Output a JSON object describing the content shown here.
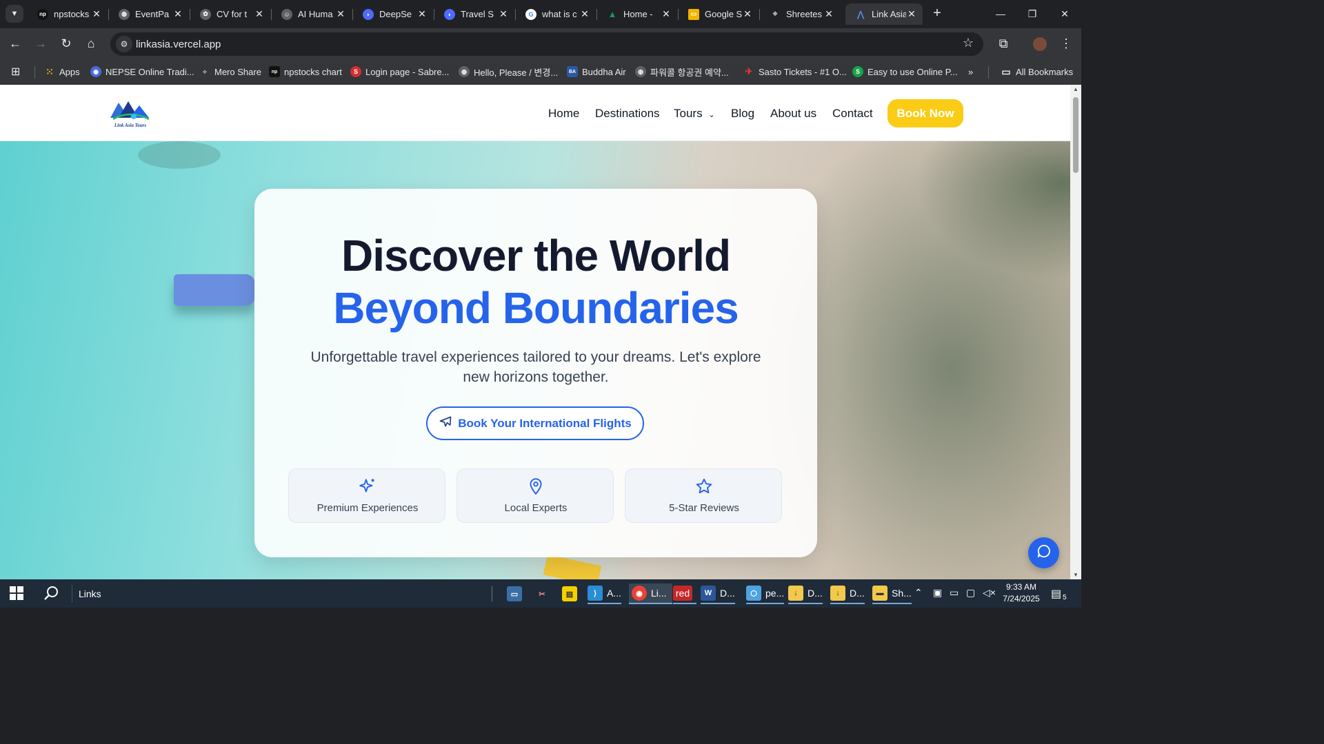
{
  "browser": {
    "tabs": [
      {
        "title": "npstocks",
        "icon": "np-icon",
        "fav_text": "np",
        "color": "#111111"
      },
      {
        "title": "EventPa",
        "icon": "globe-icon",
        "fav_text": "",
        "color": "#5f6368"
      },
      {
        "title": "CV for t",
        "icon": "openai-icon",
        "fav_text": "",
        "color": "#5f6368"
      },
      {
        "title": "AI Huma",
        "icon": "humanize-icon",
        "fav_text": "",
        "color": "#5f6368"
      },
      {
        "title": "DeepSe",
        "icon": "deepseek-icon",
        "fav_text": "",
        "color": "#4d6bfe"
      },
      {
        "title": "Travel S",
        "icon": "deepseek-icon",
        "fav_text": "",
        "color": "#4d6bfe"
      },
      {
        "title": "what is c",
        "icon": "google-icon",
        "fav_text": "G",
        "color": "#4285f4"
      },
      {
        "title": "Home - ",
        "icon": "drive-icon",
        "fav_text": "",
        "color": "#0f9d58"
      },
      {
        "title": "Google S",
        "icon": "slides-icon",
        "fav_text": "",
        "color": "#f4b400"
      },
      {
        "title": "Shreetes",
        "icon": "shreetes-icon",
        "fav_text": "",
        "color": "#5f6368"
      },
      {
        "title": "Link Asia",
        "icon": "linkasia-icon",
        "fav_text": "",
        "color": "#2563eb",
        "active": true
      }
    ],
    "url": "linkasia.vercel.app",
    "bookmarks": [
      {
        "label": "Apps",
        "icon": "apps-grid-icon",
        "color": "#e8eaed"
      },
      {
        "label": "NEPSE Online Tradi...",
        "icon": "nepse-icon",
        "color": "#4a6bd6"
      },
      {
        "label": "Mero Share",
        "icon": "mero-share-icon",
        "color": "#5f6368"
      },
      {
        "label": "npstocks chart",
        "icon": "np-icon",
        "color": "#111111"
      },
      {
        "label": "Login page - Sabre...",
        "icon": "sabre-icon",
        "color": "#d32f2f"
      },
      {
        "label": "Hello, Please / 변경...",
        "icon": "globe-icon",
        "color": "#5f6368"
      },
      {
        "label": "Buddha Air",
        "icon": "buddha-air-icon",
        "color": "#2b5aa0"
      },
      {
        "label": "파워콜 항공권 예약...",
        "icon": "globe-icon",
        "color": "#5f6368"
      },
      {
        "label": "Sasto Tickets - #1 O...",
        "icon": "plane-icon",
        "color": "#d32f2f"
      },
      {
        "label": "Easy to use Online P...",
        "icon": "s-icon",
        "color": "#16a34a"
      }
    ],
    "all_bookmarks": "All Bookmarks"
  },
  "site": {
    "logo_text": "Link Asia Tours",
    "nav": [
      "Home",
      "Destinations",
      "Tours",
      "Blog",
      "About us",
      "Contact"
    ],
    "book_now": "Book Now",
    "accent": "#2563eb",
    "cta_color": "#facc15"
  },
  "hero": {
    "title_line1": "Discover the World",
    "title_line2": "Beyond Boundaries",
    "subtitle": "Unforgettable travel experiences tailored to your dreams. Let's explore new horizons together.",
    "flights_button": "Book Your International Flights",
    "features": [
      {
        "label": "Premium Experiences",
        "icon": "sparkles-icon"
      },
      {
        "label": "Local Experts",
        "icon": "map-pin-icon"
      },
      {
        "label": "5-Star Reviews",
        "icon": "star-icon"
      }
    ]
  },
  "taskbar": {
    "search_label": "Links",
    "apps": [
      {
        "label": "A...",
        "icon": "vscode-icon",
        "color": "#2b8dd6"
      },
      {
        "label": "Li...",
        "icon": "chrome-icon",
        "color": "#e94235"
      },
      {
        "label": "red",
        "icon": "red-app-icon",
        "color": "#c62828"
      },
      {
        "label": "D...",
        "icon": "word-icon",
        "color": "#2b579a"
      },
      {
        "label": "pe...",
        "icon": "app-icon",
        "color": "#4fa3e0"
      },
      {
        "label": "D...",
        "icon": "folder-download-icon",
        "color": "#f2c94c"
      },
      {
        "label": "D...",
        "icon": "folder-download-icon",
        "color": "#f2c94c"
      },
      {
        "label": "Sh...",
        "icon": "folder-icon",
        "color": "#f2c94c"
      }
    ],
    "time": "9:33 AM",
    "date": "7/24/2025",
    "notifications": "5"
  }
}
